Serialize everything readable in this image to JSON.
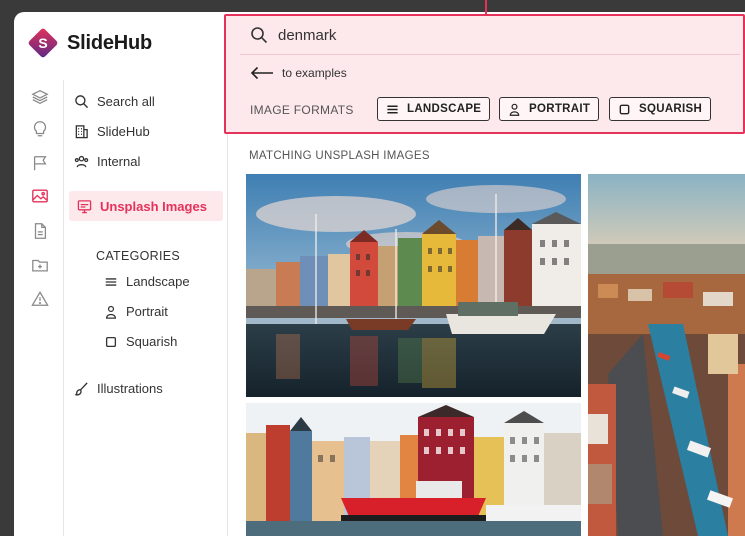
{
  "app": {
    "name_bold": "Slide",
    "name_rest": "Hub",
    "logo_letter": "S"
  },
  "rail": {
    "icons": [
      "layers-icon",
      "lightbulb-icon",
      "flag-icon",
      "image-icon",
      "document-icon",
      "folder-plus-icon",
      "warning-icon"
    ]
  },
  "nav": {
    "search_all": "Search all",
    "slidehub": "SlideHub",
    "internal": "Internal",
    "unsplash": "Unsplash Images",
    "categories_title": "CATEGORIES",
    "categories": [
      "Landscape",
      "Portrait",
      "Squarish"
    ],
    "illustrations": "Illustrations"
  },
  "search": {
    "value": "denmark",
    "back_label": "to examples",
    "formats_label": "IMAGE FORMATS",
    "formats": [
      "LANDSCAPE",
      "PORTRAIT",
      "SQUARISH"
    ]
  },
  "results": {
    "title": "MATCHING UNSPLASH IMAGES"
  },
  "colors": {
    "accent": "#e5325a",
    "accent_bg": "#fde8ec",
    "logo_purple": "#5b2a86"
  }
}
